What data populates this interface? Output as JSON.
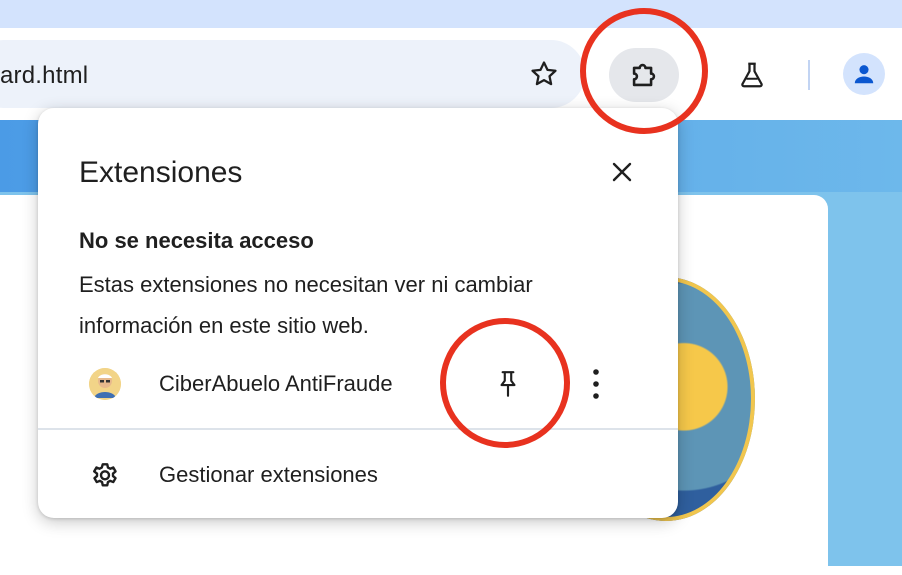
{
  "browser": {
    "address_text": "ard.html",
    "icons": [
      "star-icon",
      "puzzle-icon",
      "flask-icon",
      "person-icon"
    ]
  },
  "popup": {
    "title": "Extensiones",
    "close_icon": "close-icon",
    "section_heading": "No se necesita acceso",
    "section_description": "Estas extensiones no necesitan ver ni cambiar información en este sitio web.",
    "extension": {
      "name": "CiberAbuelo AntiFraude",
      "pin_icon": "pin-icon",
      "more_icon": "more-vert-icon"
    },
    "manage": {
      "label": "Gestionar extensiones",
      "icon": "gear-icon"
    }
  },
  "colors": {
    "annotation": "#e8321f",
    "tabstrip": "#d3e3fd",
    "omnibox": "#edf2fa",
    "page_background": "#7ec3ec"
  }
}
